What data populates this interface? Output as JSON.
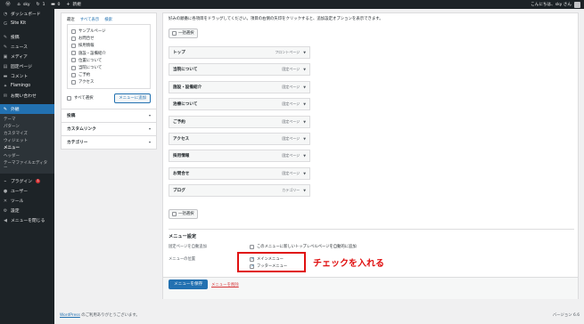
{
  "adminbar": {
    "site_name": "sky",
    "updates_count": "1",
    "comments_count": "0",
    "new_label": "新規",
    "greeting": "こんにちは、sky さん"
  },
  "sidebar": {
    "items": [
      {
        "label": "ダッシュボード",
        "icon": "dashboard-icon"
      },
      {
        "label": "Site Kit",
        "icon": "sitekit-icon"
      },
      {
        "label": "投稿",
        "icon": "pin-icon"
      },
      {
        "label": "ニュース",
        "icon": "pin-icon"
      },
      {
        "label": "メディア",
        "icon": "media-icon"
      },
      {
        "label": "固定ページ",
        "icon": "page-icon"
      },
      {
        "label": "コメント",
        "icon": "comment-icon"
      },
      {
        "label": "Flamingo",
        "icon": "flamingo-icon"
      },
      {
        "label": "お問い合わせ",
        "icon": "mail-icon"
      },
      {
        "label": "外観",
        "icon": "appearance-icon"
      }
    ],
    "submenu": [
      "テーマ",
      "パターン",
      "カスタマイズ",
      "ウィジェット",
      "メニュー",
      "ヘッダー",
      "テーマファイルエディター"
    ],
    "items_after": [
      {
        "label": "プラグイン",
        "icon": "plugin-icon",
        "badge": "1"
      },
      {
        "label": "ユーザー",
        "icon": "user-icon"
      },
      {
        "label": "ツール",
        "icon": "tool-icon"
      },
      {
        "label": "設定",
        "icon": "settings-icon"
      },
      {
        "label": "メニューを閉じる",
        "icon": "collapse-icon"
      }
    ]
  },
  "left_panel": {
    "tabs": [
      "最近",
      "すべて表示",
      "検索"
    ],
    "pages": [
      "サンプルページ",
      "お問合せ",
      "採用情報",
      "施設・設備紹介",
      "位置について",
      "当院について",
      "ご予約",
      "アクセス"
    ],
    "select_all": "すべて選択",
    "add_button": "メニューに追加",
    "accordions": [
      "投稿",
      "カスタムリンク",
      "カテゴリー"
    ]
  },
  "structure": {
    "intro": "好みの順番に各項目をドラッグしてください。項目の右側の矢印をクリックすると、追加設定オプションを表示できます。",
    "bulk_select": "一括選択",
    "items": [
      {
        "title": "トップ",
        "type": "フロントページ"
      },
      {
        "title": "当院について",
        "type": "固定ページ"
      },
      {
        "title": "施設・設備紹介",
        "type": "固定ページ"
      },
      {
        "title": "治療について",
        "type": "固定ページ"
      },
      {
        "title": "ご予約",
        "type": "固定ページ"
      },
      {
        "title": "アクセス",
        "type": "固定ページ"
      },
      {
        "title": "採用情報",
        "type": "固定ページ"
      },
      {
        "title": "お問合せ",
        "type": "固定ページ"
      },
      {
        "title": "ブログ",
        "type": "カテゴリー"
      }
    ]
  },
  "settings": {
    "heading": "メニュー設定",
    "auto_add_label": "固定ページを自動追加",
    "auto_add_text": "このメニューに新しいトップレベルページを自動的に追加",
    "location_label": "メニューの位置",
    "locations": [
      {
        "label": "メインメニュー",
        "checked": true
      },
      {
        "label": "フッターメニュー",
        "checked": true
      }
    ],
    "save_button": "メニューを保存",
    "delete_link": "メニューを削除"
  },
  "annotation": {
    "text": "チェックを入れる",
    "color": "#e01010"
  },
  "footer": {
    "wp_link": "WordPress",
    "thanks": " のご利用ありがとうございます。",
    "version": "バージョン 6.6"
  },
  "colors": {
    "accent": "#2271b1",
    "adminbar": "#1d2327"
  }
}
